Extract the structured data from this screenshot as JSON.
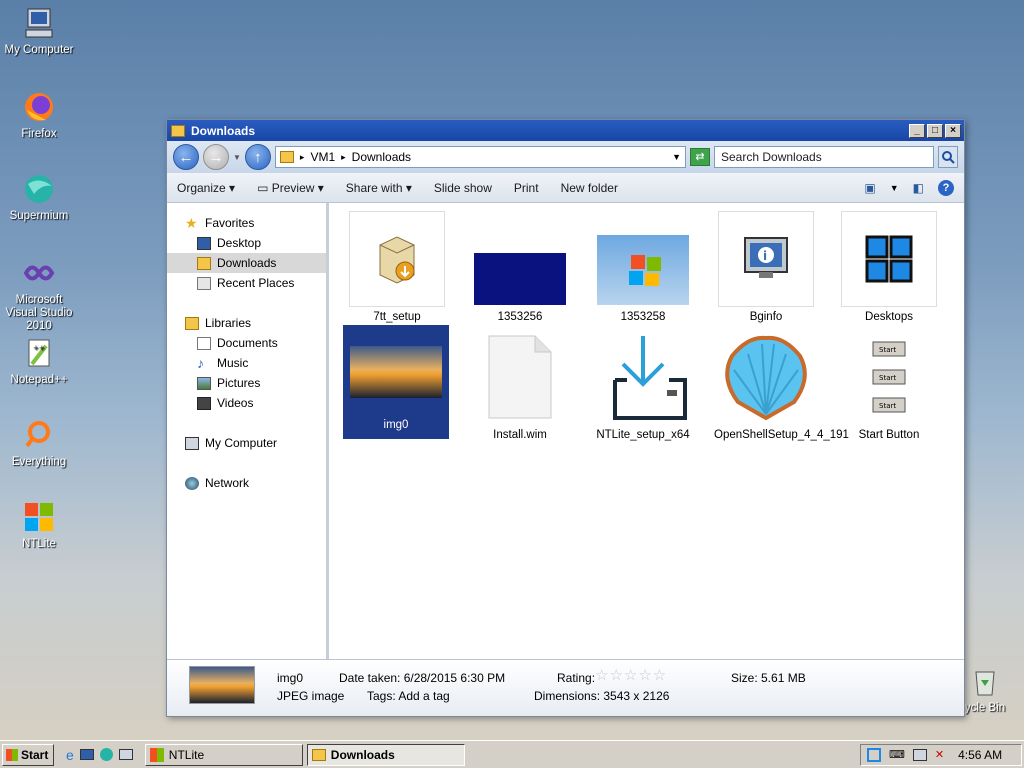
{
  "desktop": {
    "icons": [
      {
        "label": "My Computer"
      },
      {
        "label": "Firefox"
      },
      {
        "label": "Supermium"
      },
      {
        "label": "Microsoft Visual Studio 2010"
      },
      {
        "label": "Notepad++"
      },
      {
        "label": "Everything"
      },
      {
        "label": "NTLite"
      },
      {
        "label": "ycle Bin"
      }
    ]
  },
  "window": {
    "title": "Downloads",
    "address": {
      "segments": [
        "VM1",
        "Downloads"
      ]
    },
    "search": {
      "placeholder": "Search Downloads"
    },
    "commands": [
      "Organize",
      "Preview",
      "Share with",
      "Slide show",
      "Print",
      "New folder"
    ],
    "nav": {
      "favorites": "Favorites",
      "desktop": "Desktop",
      "downloads": "Downloads",
      "recent": "Recent Places",
      "libraries": "Libraries",
      "documents": "Documents",
      "music": "Music",
      "pictures": "Pictures",
      "videos": "Videos",
      "my_computer": "My Computer",
      "network": "Network"
    },
    "files": [
      {
        "name": "7tt_setup"
      },
      {
        "name": "1353256"
      },
      {
        "name": "1353258"
      },
      {
        "name": "Bginfo"
      },
      {
        "name": "Desktops"
      },
      {
        "name": "img0"
      },
      {
        "name": "Install.wim"
      },
      {
        "name": "NTLite_setup_x64"
      },
      {
        "name": "OpenShellSetup_4_4_191"
      },
      {
        "name": "Start Button"
      }
    ],
    "details": {
      "name": "img0",
      "type": "JPEG image",
      "date_taken": "Date taken: 6/28/2015 6:30 PM",
      "tags": "Tags: Add a tag",
      "rating_label": "Rating:",
      "rating": 0,
      "dimensions": "Dimensions: 3543 x 2126",
      "size": "Size: 5.61 MB"
    }
  },
  "taskbar": {
    "start": "Start",
    "tasks": [
      {
        "label": "NTLite"
      },
      {
        "label": "Downloads"
      }
    ],
    "clock": "4:56 AM"
  }
}
